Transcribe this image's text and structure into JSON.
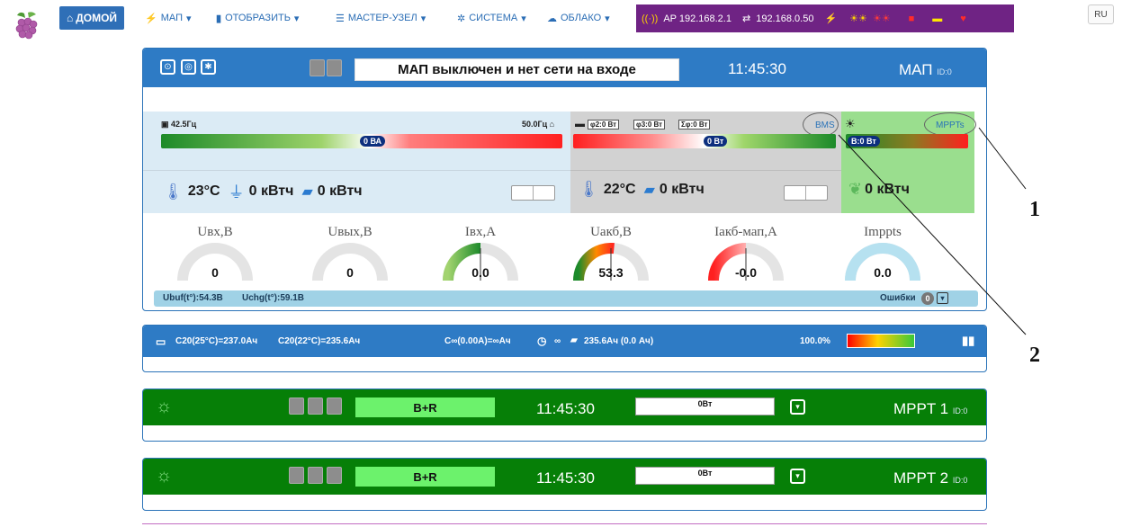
{
  "nav": {
    "home": "ДОМОЙ",
    "items": [
      "МАП",
      "ОТОБРАЗИТЬ",
      "МАСТЕР-УЗЕЛ",
      "СИСТЕМА",
      "ОБЛАКО"
    ],
    "ap_ip": "AP 192.168.2.1",
    "lan_ip": "192.168.0.50",
    "lang": "RU"
  },
  "map_panel": {
    "status_message": "МАП выключен и нет сети на входе",
    "time": "11:45:30",
    "title": "МАП",
    "id": "ID:0",
    "grid": {
      "freq_left": "42.5Гц",
      "freq_right": "50.0Гц",
      "va_pill": "0 ВА",
      "temp": "23°C",
      "energy_in": "0 кВтч",
      "energy_out": "0 кВтч"
    },
    "battery": {
      "phi2": "φ2:0 Вт",
      "phi3": "φ3:0 Вт",
      "phi_sum": "Σφ:0 Вт",
      "bms": "BMS",
      "w_pill": "0 Вт",
      "temp": "22°C",
      "energy": "0 кВтч"
    },
    "pv": {
      "mppts": "MPPTs",
      "b_pill": "B:0 Вт",
      "energy": "0 кВтч"
    },
    "gauges": [
      {
        "label": "Uвх,В",
        "value": "0",
        "fill": 0
      },
      {
        "label": "Uвых,В",
        "value": "0",
        "fill": 0
      },
      {
        "label": "Iвх,А",
        "value": "0.0",
        "fill": 0.5
      },
      {
        "label": "Uакб,В",
        "value": "53.3",
        "fill": 0.53
      },
      {
        "label": "Iакб-мап,А",
        "value": "-0.0",
        "fill": 0.5
      },
      {
        "label": "Imppts",
        "value": "0.0",
        "fill": 1
      }
    ],
    "footer": {
      "ubuf": "Ubuf(t°):54.3В",
      "uchg": "Uchg(t°):59.1В",
      "errors_label": "Ошибки",
      "errors_count": "0"
    }
  },
  "battery_panel": {
    "c20_25": "C20(25°C)=237.0Ач",
    "c20_22": "C20(22°C)=235.6Ач",
    "c_inf": "C∞(0.00А)=∞Ач",
    "remaining": "∞",
    "capacity": "235.6Ач (0.0 Ач)",
    "soc": "100.0%"
  },
  "mppts": [
    {
      "mode": "B+R",
      "time": "11:45:30",
      "power": "0Вт",
      "title": "MPPT 1",
      "id": "ID:0"
    },
    {
      "mode": "B+R",
      "time": "11:45:30",
      "power": "0Вт",
      "title": "MPPT 2",
      "id": "ID:0"
    }
  ],
  "annotations": [
    "1",
    "2"
  ],
  "colors": {
    "accent": "#2e7bc5",
    "mppt_bg": "#067f07",
    "status_bar": "#6f2384"
  }
}
